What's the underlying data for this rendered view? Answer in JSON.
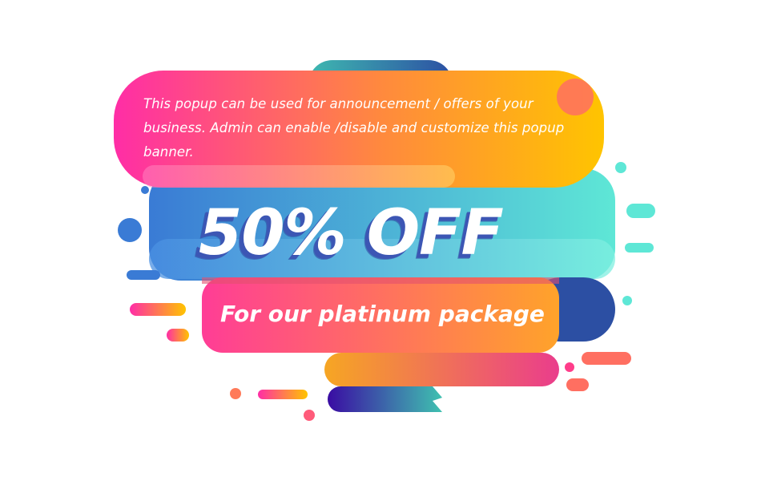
{
  "banner": {
    "announcement": "This popup can be used for announcement / offers of your business. Admin can enable /disable and customize this popup banner.",
    "headline": "50% OFF",
    "subline": "For our platinum package"
  },
  "colors": {
    "background": "#ffffff",
    "pink": "#ff2d9b",
    "orange": "#ff8a3d",
    "yellow": "#ffc400",
    "blue": "#3a7bd5",
    "teal": "#5ee7d6",
    "navy": "#2c4fa3",
    "purple": "#3a0ca3"
  }
}
